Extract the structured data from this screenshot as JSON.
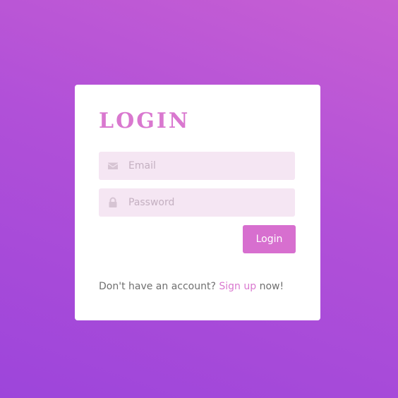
{
  "login_card": {
    "title": "LOGIN",
    "email": {
      "placeholder": "Email",
      "value": "",
      "icon": "envelope-icon"
    },
    "password": {
      "placeholder": "Password",
      "value": "",
      "icon": "lock-icon"
    },
    "submit_label": "Login",
    "signup": {
      "prefix": "Don't have an account?",
      "link_label": "Sign up",
      "suffix": "now!"
    }
  },
  "colors": {
    "background_top": "#c75fd3",
    "background_bottom": "#9d45da",
    "accent": "#d978cf",
    "button": "#d76fcf",
    "input_bg": "#f5e6f3",
    "card_bg": "#ffffff"
  }
}
